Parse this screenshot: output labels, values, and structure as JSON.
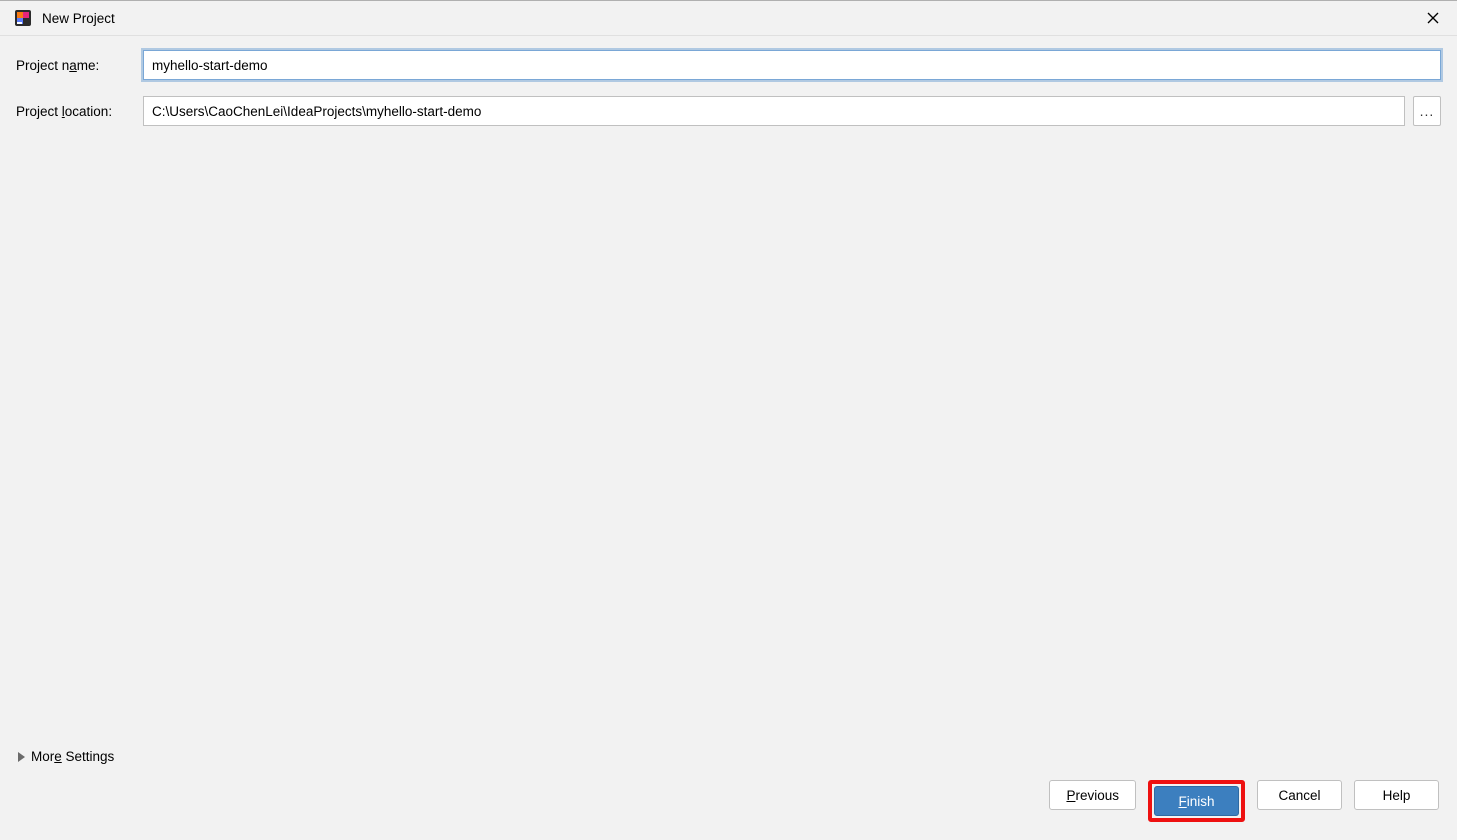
{
  "window": {
    "title": "New Project"
  },
  "form": {
    "projectNameLabelPrefix": "Project n",
    "projectNameLabelUl": "a",
    "projectNameLabelSuffix": "me:",
    "projectNameValue": "myhello-start-demo",
    "projectLocationLabelPrefix": "Project ",
    "projectLocationLabelUl": "l",
    "projectLocationLabelSuffix": "ocation:",
    "projectLocationValue": "C:\\Users\\CaoChenLei\\IdeaProjects\\myhello-start-demo",
    "browseLabel": "..."
  },
  "moreSettings": {
    "prefix": "Mor",
    "ul": "e",
    "suffix": " Settings"
  },
  "buttons": {
    "previousUl": "P",
    "previousSuffix": "revious",
    "finishUl": "F",
    "finishSuffix": "inish",
    "cancel": "Cancel",
    "help": "Help"
  }
}
